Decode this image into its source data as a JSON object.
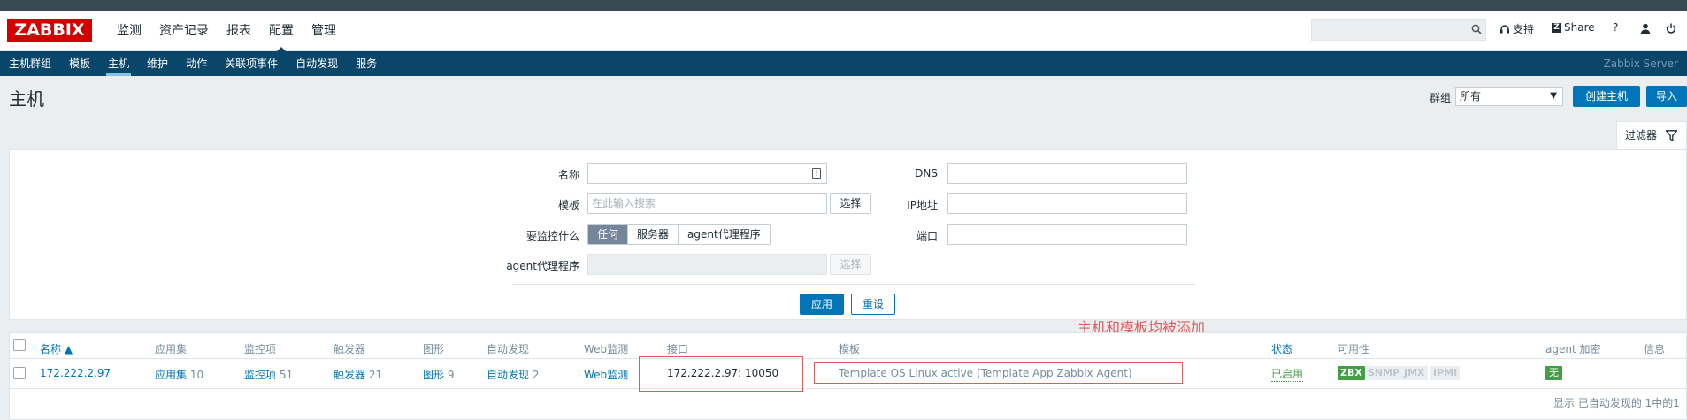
{
  "app": {
    "logo": "ZABBIX",
    "server_label": "Zabbix Server"
  },
  "main_menu": [
    "监测",
    "资产记录",
    "报表",
    "配置",
    "管理"
  ],
  "header_links": {
    "support": "支持",
    "share": "Share",
    "help": "?"
  },
  "sub_menu": [
    "主机群组",
    "模板",
    "主机",
    "维护",
    "动作",
    "关联项事件",
    "自动发现",
    "服务"
  ],
  "page": {
    "title": "主机",
    "group_label": "群组",
    "group_value": "所有",
    "create_button": "创建主机",
    "import_button": "导入"
  },
  "filter": {
    "tab_label": "过滤器",
    "name_label": "名称",
    "template_label": "模板",
    "template_placeholder": "在此输入搜索",
    "select_button": "选择",
    "monitor_label": "要监控什么",
    "monitor_options": [
      "任何",
      "服务器",
      "agent代理程序"
    ],
    "proxy_label": "agent代理程序",
    "proxy_select_button": "选择",
    "dns_label": "DNS",
    "ip_label": "IP地址",
    "port_label": "端口",
    "apply_button": "应用",
    "reset_button": "重设"
  },
  "annotation": "主机和模板均被添加",
  "table": {
    "headers": {
      "name": "名称 ▲",
      "applications": "应用集",
      "items": "监控项",
      "triggers": "触发器",
      "graphs": "图形",
      "discovery": "自动发现",
      "web": "Web监测",
      "interface": "接口",
      "templates": "模板",
      "status": "状态",
      "availability": "可用性",
      "encryption": "agent 加密",
      "info": "信息"
    },
    "row": {
      "name": "172.222.2.97",
      "applications": "应用集",
      "applications_count": "10",
      "items": "监控项",
      "items_count": "51",
      "triggers": "触发器",
      "triggers_count": "21",
      "graphs": "图形",
      "graphs_count": "9",
      "discovery": "自动发现",
      "discovery_count": "2",
      "web": "Web监测",
      "interface": "172.222.2.97: 10050",
      "templates": "Template OS Linux active (Template App Zabbix Agent)",
      "status": "已启用",
      "availability": [
        "ZBX",
        "SNMP",
        "JMX",
        "IPMI"
      ],
      "encryption": "无"
    },
    "footer": "显示 已自动发现的 1中的1"
  },
  "colors": {
    "brand": "#d40000",
    "nav": "#0a466a",
    "accent": "#0275b8",
    "ok": "#429e47",
    "annotation": "#e45959"
  }
}
